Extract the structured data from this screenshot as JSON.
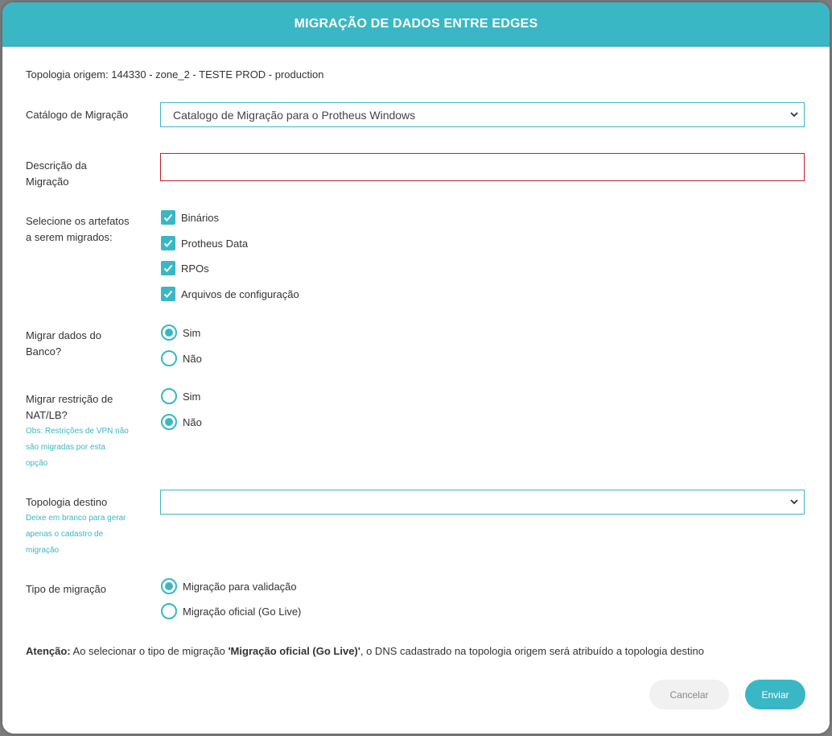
{
  "modal": {
    "title": "MIGRAÇÃO DE DADOS ENTRE EDGES"
  },
  "form": {
    "topology_origin": "Topologia origem: 144330 - zone_2 - TESTE PROD - production",
    "catalog": {
      "label": "Catálogo de Migração",
      "selected": "Catalogo de Migração para o Protheus Windows",
      "icon": "chevron-down-icon"
    },
    "description": {
      "label_line1": "Descrição da",
      "label_line2": "Migração",
      "value": "",
      "border_color": "#c21d2c"
    },
    "artifacts": {
      "label_line1": "Selecione os artefatos",
      "label_line2": "a serem migrados:",
      "items": [
        {
          "label": "Binários",
          "checked": true
        },
        {
          "label": "Protheus Data",
          "checked": true
        },
        {
          "label": "RPOs",
          "checked": true
        },
        {
          "label": "Arquivos de configuração",
          "checked": true
        }
      ]
    },
    "migrate_db": {
      "label_line1": "Migrar dados do",
      "label_line2": "Banco?",
      "options": [
        {
          "label": "Sim",
          "selected": true
        },
        {
          "label": "Não",
          "selected": false
        }
      ]
    },
    "migrate_nat": {
      "label_line1": "Migrar restrição de",
      "label_line2": "NAT/LB?",
      "note_line1": "Obs: Restrições de VPN não",
      "note_line2": "são migradas por esta",
      "note_line3": "opção",
      "options": [
        {
          "label": "Sim",
          "selected": false
        },
        {
          "label": "Não",
          "selected": true
        }
      ]
    },
    "topology_dest": {
      "label": "Topologia destino",
      "note_line1": "Deixe em branco para gerar",
      "note_line2": "apenas o cadastro de",
      "note_line3": "migração",
      "selected": "",
      "icon": "chevron-down-icon"
    },
    "migration_type": {
      "label": "Tipo de migração",
      "options": [
        {
          "label": "Migração para validação",
          "selected": true
        },
        {
          "label": "Migração oficial (Go Live)",
          "selected": false
        }
      ]
    },
    "warning": {
      "prefix": "Atenção:",
      "text1": " Ao selecionar o tipo de migração ",
      "highlight": "'Migração oficial (Go Live)'",
      "text2": ", o DNS cadastrado na topologia origem será atribuído a topologia destino"
    }
  },
  "buttons": {
    "cancel": "Cancelar",
    "submit": "Enviar"
  },
  "colors": {
    "accent": "#3ab7c5",
    "error": "#c21d2c",
    "checkbox_icon": "check-icon",
    "radio_icon": "radio-icon"
  }
}
